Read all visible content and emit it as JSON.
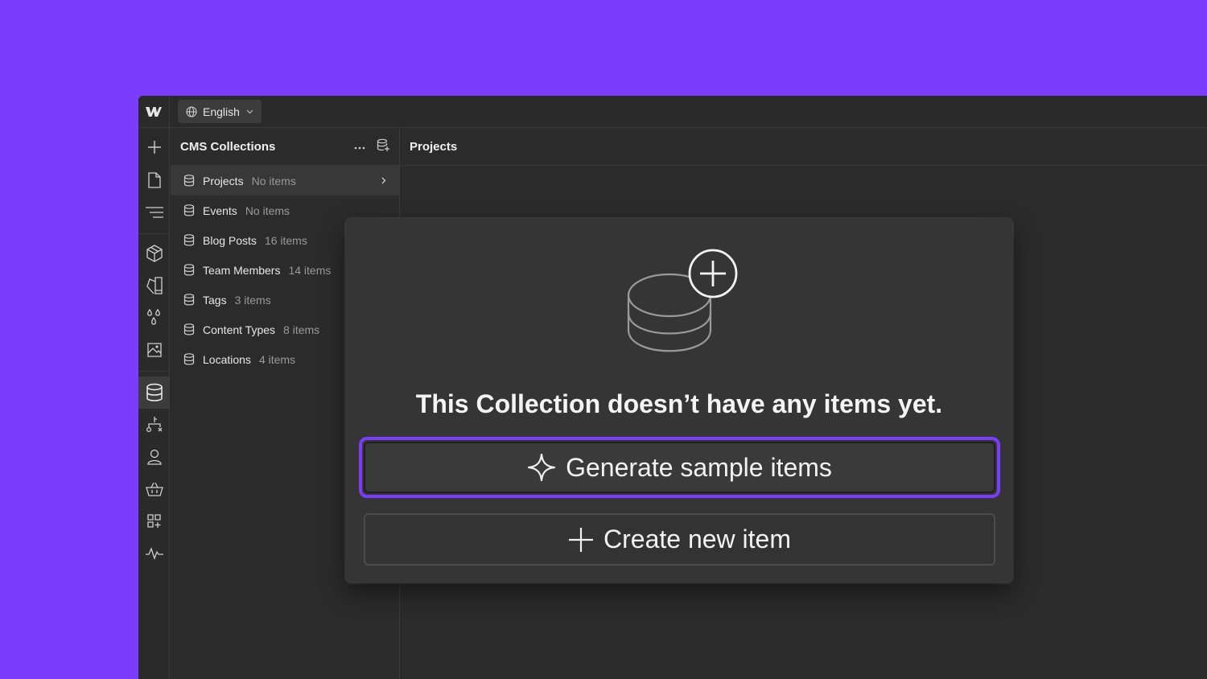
{
  "topbar": {
    "language_label": "English"
  },
  "panel": {
    "title": "CMS Collections",
    "collections": [
      {
        "name": "Projects",
        "count": "No items"
      },
      {
        "name": "Events",
        "count": "No items"
      },
      {
        "name": "Blog Posts",
        "count": "16 items"
      },
      {
        "name": "Team Members",
        "count": "14 items"
      },
      {
        "name": "Tags",
        "count": "3 items"
      },
      {
        "name": "Content Types",
        "count": "8 items"
      },
      {
        "name": "Locations",
        "count": "4 items"
      }
    ]
  },
  "main": {
    "title": "Projects"
  },
  "empty_state": {
    "message": "This Collection doesn’t have any items yet.",
    "generate_label": "Generate sample items",
    "create_label": "Create new item"
  },
  "colors": {
    "accent": "#7b3cfb",
    "background": "#2b2b2b"
  }
}
